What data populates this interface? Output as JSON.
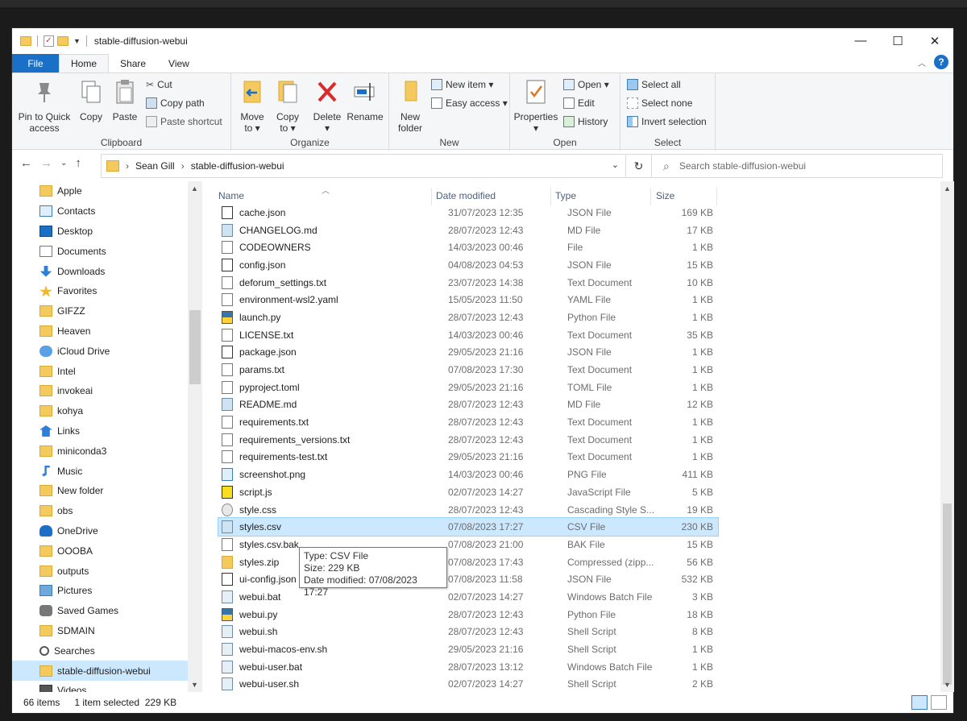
{
  "window": {
    "title": "stable-diffusion-webui"
  },
  "ribbon_tabs": [
    "File",
    "Home",
    "Share",
    "View"
  ],
  "ribbon": {
    "clipboard": {
      "label": "Clipboard",
      "pin": "Pin to Quick access",
      "copy": "Copy",
      "paste": "Paste",
      "cut": "Cut",
      "copy_path": "Copy path",
      "paste_shortcut": "Paste shortcut"
    },
    "organize": {
      "label": "Organize",
      "move_to": "Move to ▾",
      "copy_to": "Copy to ▾",
      "delete": "Delete ▾",
      "rename": "Rename"
    },
    "new": {
      "label": "New",
      "new_folder": "New folder",
      "new_item": "New item ▾",
      "easy_access": "Easy access ▾"
    },
    "open": {
      "label": "Open",
      "properties": "Properties ▾",
      "open": "Open ▾",
      "edit": "Edit",
      "history": "History"
    },
    "select": {
      "label": "Select",
      "select_all": "Select all",
      "select_none": "Select none",
      "invert": "Invert selection"
    }
  },
  "address": {
    "crumbs": [
      "Sean Gill",
      "stable-diffusion-webui"
    ]
  },
  "search": {
    "placeholder": "Search stable-diffusion-webui"
  },
  "nav_items": [
    {
      "label": "Apple",
      "icon": "folder-icon"
    },
    {
      "label": "Contacts",
      "icon": "contacts-icon"
    },
    {
      "label": "Desktop",
      "icon": "desktop-icon"
    },
    {
      "label": "Documents",
      "icon": "documents-icon"
    },
    {
      "label": "Downloads",
      "icon": "downloads-icon"
    },
    {
      "label": "Favorites",
      "icon": "star-icon"
    },
    {
      "label": "GIFZZ",
      "icon": "folder-icon"
    },
    {
      "label": "Heaven",
      "icon": "folder-icon"
    },
    {
      "label": "iCloud Drive",
      "icon": "cloud-icon"
    },
    {
      "label": "Intel",
      "icon": "folder-icon"
    },
    {
      "label": "invokeai",
      "icon": "folder-icon"
    },
    {
      "label": "kohya",
      "icon": "folder-icon"
    },
    {
      "label": "Links",
      "icon": "links-icon"
    },
    {
      "label": "miniconda3",
      "icon": "folder-icon"
    },
    {
      "label": "Music",
      "icon": "music-icon"
    },
    {
      "label": "New folder",
      "icon": "folder-icon"
    },
    {
      "label": "obs",
      "icon": "folder-icon"
    },
    {
      "label": "OneDrive",
      "icon": "onedrive-icon"
    },
    {
      "label": "OOOBA",
      "icon": "folder-icon"
    },
    {
      "label": "outputs",
      "icon": "folder-icon"
    },
    {
      "label": "Pictures",
      "icon": "pictures-icon"
    },
    {
      "label": "Saved Games",
      "icon": "games-icon"
    },
    {
      "label": "SDMAIN",
      "icon": "folder-icon"
    },
    {
      "label": "Searches",
      "icon": "search-icon"
    },
    {
      "label": "stable-diffusion-webui",
      "icon": "folder-icon",
      "selected": true
    },
    {
      "label": "Videos",
      "icon": "videos-icon"
    }
  ],
  "columns": {
    "name": "Name",
    "date": "Date modified",
    "type": "Type",
    "size": "Size"
  },
  "files": [
    {
      "name": "cache.json",
      "date": "31/07/2023 12:35",
      "type": "JSON File",
      "size": "169 KB"
    },
    {
      "name": "CHANGELOG.md",
      "date": "28/07/2023 12:43",
      "type": "MD File",
      "size": "17 KB"
    },
    {
      "name": "CODEOWNERS",
      "date": "14/03/2023 00:46",
      "type": "File",
      "size": "1 KB"
    },
    {
      "name": "config.json",
      "date": "04/08/2023 04:53",
      "type": "JSON File",
      "size": "15 KB"
    },
    {
      "name": "deforum_settings.txt",
      "date": "23/07/2023 14:38",
      "type": "Text Document",
      "size": "10 KB"
    },
    {
      "name": "environment-wsl2.yaml",
      "date": "15/05/2023 11:50",
      "type": "YAML File",
      "size": "1 KB"
    },
    {
      "name": "launch.py",
      "date": "28/07/2023 12:43",
      "type": "Python File",
      "size": "1 KB"
    },
    {
      "name": "LICENSE.txt",
      "date": "14/03/2023 00:46",
      "type": "Text Document",
      "size": "35 KB"
    },
    {
      "name": "package.json",
      "date": "29/05/2023 21:16",
      "type": "JSON File",
      "size": "1 KB"
    },
    {
      "name": "params.txt",
      "date": "07/08/2023 17:30",
      "type": "Text Document",
      "size": "1 KB"
    },
    {
      "name": "pyproject.toml",
      "date": "29/05/2023 21:16",
      "type": "TOML File",
      "size": "1 KB"
    },
    {
      "name": "README.md",
      "date": "28/07/2023 12:43",
      "type": "MD File",
      "size": "12 KB"
    },
    {
      "name": "requirements.txt",
      "date": "28/07/2023 12:43",
      "type": "Text Document",
      "size": "1 KB"
    },
    {
      "name": "requirements_versions.txt",
      "date": "28/07/2023 12:43",
      "type": "Text Document",
      "size": "1 KB"
    },
    {
      "name": "requirements-test.txt",
      "date": "29/05/2023 21:16",
      "type": "Text Document",
      "size": "1 KB"
    },
    {
      "name": "screenshot.png",
      "date": "14/03/2023 00:46",
      "type": "PNG File",
      "size": "411 KB"
    },
    {
      "name": "script.js",
      "date": "02/07/2023 14:27",
      "type": "JavaScript File",
      "size": "5 KB"
    },
    {
      "name": "style.css",
      "date": "28/07/2023 12:43",
      "type": "Cascading Style S...",
      "size": "19 KB"
    },
    {
      "name": "styles.csv",
      "date": "07/08/2023 17:27",
      "type": "CSV File",
      "size": "230 KB",
      "selected": true
    },
    {
      "name": "styles.csv.bak",
      "date": "07/08/2023 21:00",
      "type": "BAK File",
      "size": "15 KB"
    },
    {
      "name": "styles.zip",
      "date": "07/08/2023 17:43",
      "type": "Compressed (zipp...",
      "size": "56 KB"
    },
    {
      "name": "ui-config.json",
      "date": "07/08/2023 11:58",
      "type": "JSON File",
      "size": "532 KB"
    },
    {
      "name": "webui.bat",
      "date": "02/07/2023 14:27",
      "type": "Windows Batch File",
      "size": "3 KB"
    },
    {
      "name": "webui.py",
      "date": "28/07/2023 12:43",
      "type": "Python File",
      "size": "18 KB"
    },
    {
      "name": "webui.sh",
      "date": "28/07/2023 12:43",
      "type": "Shell Script",
      "size": "8 KB"
    },
    {
      "name": "webui-macos-env.sh",
      "date": "29/05/2023 21:16",
      "type": "Shell Script",
      "size": "1 KB"
    },
    {
      "name": "webui-user.bat",
      "date": "28/07/2023 13:12",
      "type": "Windows Batch File",
      "size": "1 KB"
    },
    {
      "name": "webui-user.sh",
      "date": "02/07/2023 14:27",
      "type": "Shell Script",
      "size": "2 KB"
    }
  ],
  "tooltip": {
    "line1": "Type: CSV File",
    "line2": "Size: 229 KB",
    "line3": "Date modified: 07/08/2023 17:27"
  },
  "status": {
    "count": "66 items",
    "selection": "1 item selected  229 KB"
  },
  "colors": {
    "accent": "#1a6fc7",
    "selection": "#cce8ff",
    "folder": "#f4c95d"
  }
}
